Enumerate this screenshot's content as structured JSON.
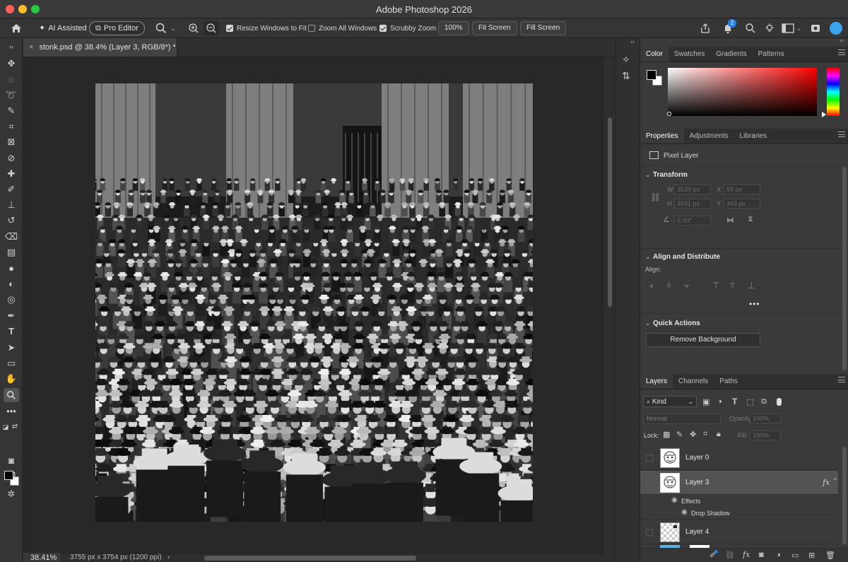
{
  "app": {
    "title": "Adobe Photoshop 2026"
  },
  "options_bar": {
    "ai_assisted": "AI Assisted",
    "pro_editor": "Pro Editor",
    "resize_windows": "Resize Windows to Fit",
    "zoom_all_windows": "Zoom All Windows",
    "scrubby_zoom": "Scrubby Zoom",
    "zoom_value": "100%",
    "fit_screen": "Fit Screen",
    "fill_screen": "Fill Screen",
    "checkbox_states": {
      "resize_windows": true,
      "zoom_all_windows": false,
      "scrubby_zoom": true
    },
    "notification_count": "2"
  },
  "document": {
    "tab_title": "stonk.psd @ 38.4% (Layer 3, RGB/8*) *",
    "zoom": "38.41%",
    "doc_info": "3755 px x 3754 px (1200 ppi)"
  },
  "color_panel": {
    "tabs": [
      "Color",
      "Swatches",
      "Gradients",
      "Patterns"
    ],
    "foreground": "#000000",
    "background": "#ffffff",
    "hue": "#ff0000"
  },
  "properties_panel": {
    "tabs": [
      "Properties",
      "Adjustments",
      "Libraries"
    ],
    "layer_type": "Pixel Layer",
    "transform_title": "Transform",
    "w_label": "W",
    "w_value": "3539 px",
    "x_label": "X",
    "x_value": "59 px",
    "h_label": "H",
    "h_value": "3591 px",
    "y_label": "Y",
    "y_value": "363 px",
    "angle_value": "0.00°",
    "align_title": "Align and Distribute",
    "align_label": "Align:",
    "quick_actions_title": "Quick Actions",
    "remove_background": "Remove Background"
  },
  "layers_panel": {
    "tabs": [
      "Layers",
      "Channels",
      "Paths"
    ],
    "kind": "Kind",
    "blend_mode": "Normal",
    "opacity_label": "Opacity:",
    "opacity_value": "100%",
    "lock_label": "Lock:",
    "fill_label": "Fill:",
    "fill_value": "100%",
    "layers": [
      {
        "name": "Layer 0",
        "selected": false
      },
      {
        "name": "Layer 3",
        "selected": true
      },
      {
        "name": "Layer 4",
        "selected": false
      }
    ],
    "effects_label": "Effects",
    "drop_shadow_label": "Drop Shadow",
    "fx_label": "fx"
  }
}
